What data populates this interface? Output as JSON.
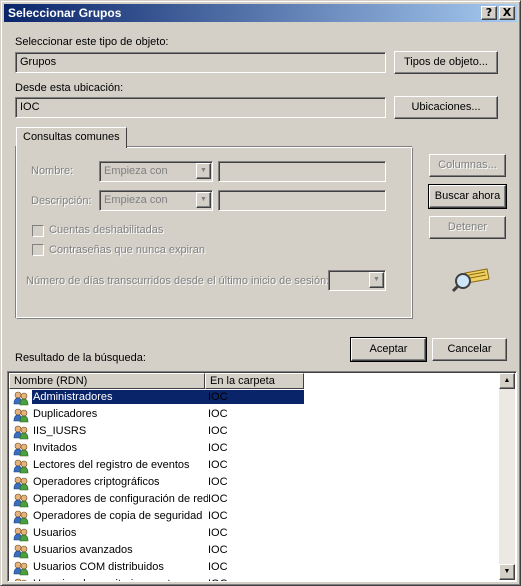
{
  "window": {
    "title": "Seleccionar Grupos",
    "help_glyph": "?",
    "close_glyph": "X"
  },
  "object_type": {
    "label": "Seleccionar este tipo de objeto:",
    "value": "Grupos",
    "button": "Tipos de objeto..."
  },
  "location": {
    "label": "Desde esta ubicación:",
    "value": "IOC",
    "button": "Ubicaciones..."
  },
  "queries": {
    "tab_label": "Consultas comunes",
    "name_label": "Nombre:",
    "name_mode": "Empieza con",
    "desc_label": "Descripción:",
    "desc_mode": "Empieza con",
    "disabled_accounts": "Cuentas deshabilitadas",
    "no_expire_passwords": "Contraseñas que nunca expiran",
    "days_label": "Número de días transcurridos desde el último inicio de sesión:"
  },
  "actions": {
    "columns": "Columnas...",
    "search_now": "Buscar ahora",
    "stop": "Detener",
    "accept": "Aceptar",
    "cancel": "Cancelar"
  },
  "results": {
    "label": "Resultado de la búsqueda:",
    "columns": [
      "Nombre (RDN)",
      "En la carpeta"
    ],
    "rows": [
      {
        "name": "Administradores",
        "folder": "IOC"
      },
      {
        "name": "Duplicadores",
        "folder": "IOC"
      },
      {
        "name": "IIS_IUSRS",
        "folder": "IOC"
      },
      {
        "name": "Invitados",
        "folder": "IOC"
      },
      {
        "name": "Lectores del registro de eventos",
        "folder": "IOC"
      },
      {
        "name": "Operadores criptográficos",
        "folder": "IOC"
      },
      {
        "name": "Operadores de configuración de red",
        "folder": "IOC"
      },
      {
        "name": "Operadores de copia de seguridad",
        "folder": "IOC"
      },
      {
        "name": "Usuarios",
        "folder": "IOC"
      },
      {
        "name": "Usuarios avanzados",
        "folder": "IOC"
      },
      {
        "name": "Usuarios COM distribuidos",
        "folder": "IOC"
      },
      {
        "name": "Usuarios de escritorio remoto",
        "folder": "IOC"
      }
    ]
  },
  "icons": {
    "group": "group-icon",
    "search": "search-magnifier-icon",
    "scroll_up": "scroll-up-arrow-icon",
    "scroll_down": "scroll-down-arrow-icon",
    "combo_arrow": "chevron-down-icon"
  },
  "colors": {
    "titlebar_start": "#0a246a",
    "titlebar_end": "#a6caf0",
    "face": "#d4d0c8",
    "selection": "#0a246a"
  }
}
